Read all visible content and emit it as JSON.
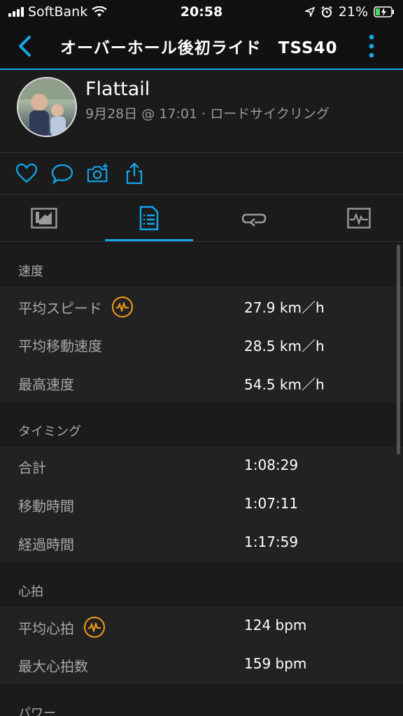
{
  "status": {
    "carrier": "SoftBank",
    "time": "20:58",
    "battery": "21%"
  },
  "appbar": {
    "title": "オーバーホール後初ライド　TSS40"
  },
  "profile": {
    "name": "Flattail",
    "meta": "9月28日 @ 17:01 · ロードサイクリング"
  },
  "tabs": [
    "overview-icon",
    "stats-icon",
    "laps-icon",
    "chart-icon"
  ],
  "sections": [
    {
      "title": "速度",
      "rows": [
        {
          "label": "平均スピード",
          "value": "27.9 km／h",
          "badge": true
        },
        {
          "label": "平均移動速度",
          "value": "28.5 km／h",
          "badge": false
        },
        {
          "label": "最高速度",
          "value": "54.5 km／h",
          "badge": false
        }
      ]
    },
    {
      "title": "タイミング",
      "rows": [
        {
          "label": "合計",
          "value": "1:08:29",
          "badge": false
        },
        {
          "label": "移動時間",
          "value": "1:07:11",
          "badge": false
        },
        {
          "label": "経過時間",
          "value": "1:17:59",
          "badge": false
        }
      ]
    },
    {
      "title": "心拍",
      "rows": [
        {
          "label": "平均心拍",
          "value": "124 bpm",
          "badge": true
        },
        {
          "label": "最大心拍数",
          "value": "159 bpm",
          "badge": false
        }
      ]
    },
    {
      "title": "パワー",
      "rows": []
    }
  ],
  "colors": {
    "accent": "#11a9ed",
    "badge": "#f39c1b"
  }
}
